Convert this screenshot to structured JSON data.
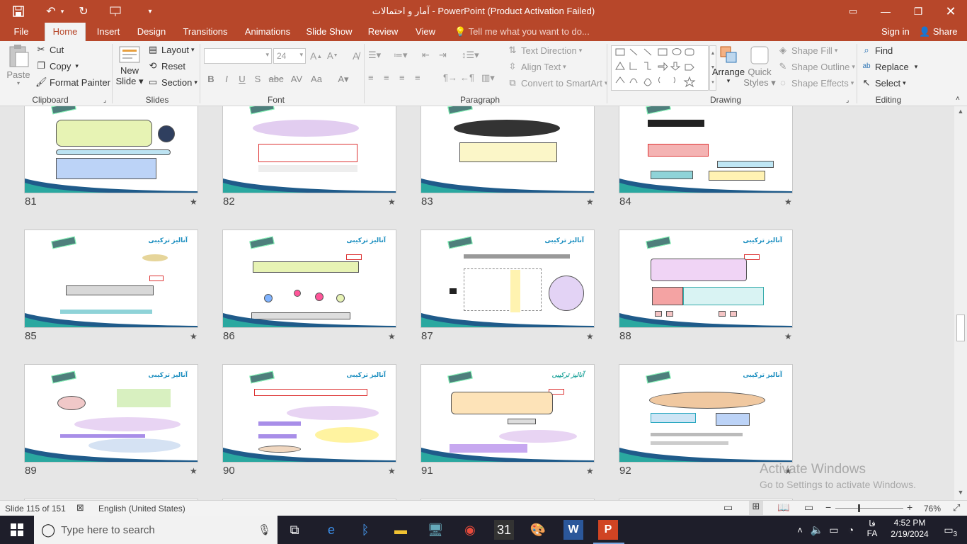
{
  "window": {
    "title": "آمار و احتمالات - PowerPoint (Product Activation Failed)"
  },
  "quick_access": {
    "save_icon": "save-icon",
    "undo_icon": "undo-icon",
    "redo_icon": "redo-icon",
    "customize_icon": "customize-icon"
  },
  "tabs": [
    {
      "label": "File"
    },
    {
      "label": "Home"
    },
    {
      "label": "Insert"
    },
    {
      "label": "Design"
    },
    {
      "label": "Transitions"
    },
    {
      "label": "Animations"
    },
    {
      "label": "Slide Show"
    },
    {
      "label": "Review"
    },
    {
      "label": "View"
    }
  ],
  "tell_me": "Tell me what you want to do...",
  "account": {
    "signin": "Sign in",
    "share": "Share"
  },
  "ribbon": {
    "clipboard": {
      "label": "Clipboard",
      "paste": "Paste",
      "cut": "Cut",
      "copy": "Copy",
      "format_painter": "Format Painter"
    },
    "slides": {
      "label": "Slides",
      "new_slide_1": "New",
      "new_slide_2": "Slide",
      "layout": "Layout",
      "reset": "Reset",
      "section": "Section"
    },
    "font": {
      "label": "Font",
      "font_name": "",
      "font_size": "24",
      "bold": "B",
      "italic": "I",
      "underline": "U",
      "shadow": "S",
      "strike": "abc"
    },
    "paragraph": {
      "label": "Paragraph",
      "text_direction": "Text Direction",
      "align_text": "Align Text",
      "convert_smartart": "Convert to SmartArt"
    },
    "drawing": {
      "label": "Drawing",
      "arrange": "Arrange",
      "quick_styles_1": "Quick",
      "quick_styles_2": "Styles",
      "shape_fill": "Shape Fill",
      "shape_outline": "Shape Outline",
      "shape_effects": "Shape Effects"
    },
    "editing": {
      "label": "Editing",
      "find": "Find",
      "replace": "Replace",
      "select": "Select"
    }
  },
  "slides": [
    {
      "number": "81",
      "title": ""
    },
    {
      "number": "82",
      "title": ""
    },
    {
      "number": "83",
      "title": ""
    },
    {
      "number": "84",
      "title": ""
    },
    {
      "number": "85",
      "title": "آنالیز ترکیبی"
    },
    {
      "number": "86",
      "title": "آنالیز ترکیبی"
    },
    {
      "number": "87",
      "title": "آنالیز ترکیبی"
    },
    {
      "number": "88",
      "title": "آنالیز ترکیبی"
    },
    {
      "number": "89",
      "title": "آنالیز ترکیبی"
    },
    {
      "number": "90",
      "title": "آنالیز ترکیبی"
    },
    {
      "number": "91",
      "title": "آنالیز ترکیبی"
    },
    {
      "number": "92",
      "title": "آنالیز ترکیبی"
    }
  ],
  "status": {
    "slide_info": "Slide 115 of 151",
    "language": "English (United States)",
    "zoom": "76%"
  },
  "watermark": {
    "line1": "Activate Windows",
    "line2": "Go to Settings to activate Windows."
  },
  "taskbar": {
    "search_placeholder": "Type here to search",
    "time": "4:52 PM",
    "date": "2/19/2024",
    "lang": "FA",
    "lang_script": "فا",
    "notifications": "3"
  }
}
